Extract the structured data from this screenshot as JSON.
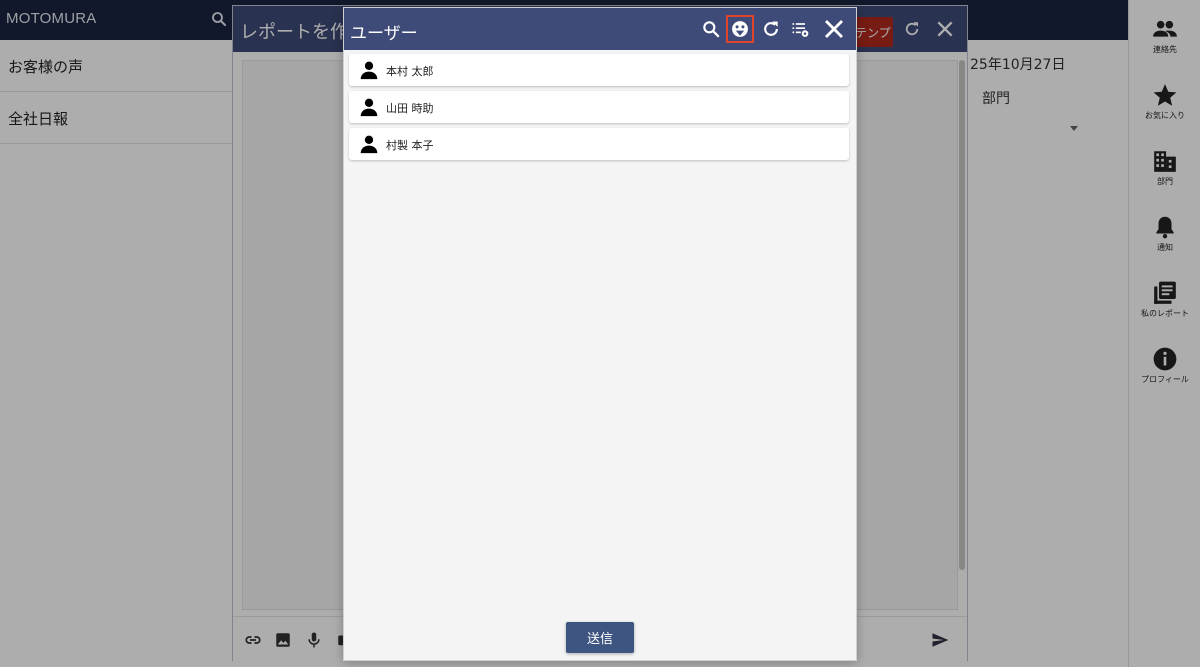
{
  "app": {
    "title": "MOTOMURA"
  },
  "left_panel": {
    "items": [
      "お客様の声",
      "全社日報"
    ]
  },
  "right_rail": {
    "items": [
      {
        "label": "連絡先",
        "icon": "contacts-icon"
      },
      {
        "label": "お気に入り",
        "icon": "star-icon"
      },
      {
        "label": "部門",
        "icon": "building-icon"
      },
      {
        "label": "通知",
        "icon": "bell-icon"
      },
      {
        "label": "私のレポート",
        "icon": "report-icon"
      },
      {
        "label": "プロフィール",
        "icon": "info-icon"
      }
    ]
  },
  "background_form": {
    "date": "25年10月27日",
    "department": "部門"
  },
  "report_dialog": {
    "title": "レポートを作成",
    "template_button": "テンプレート"
  },
  "user_modal": {
    "title": "ユーザー",
    "users": [
      {
        "name": "本村 太郎"
      },
      {
        "name": "山田 時助"
      },
      {
        "name": "村製 本子"
      }
    ],
    "send_button": "送信"
  },
  "colors": {
    "app_header": "#1a2440",
    "dialog_header": "#3e4a78",
    "send_button": "#3d5580",
    "highlight": "#e0452c",
    "template_button": "#b02a1e"
  }
}
